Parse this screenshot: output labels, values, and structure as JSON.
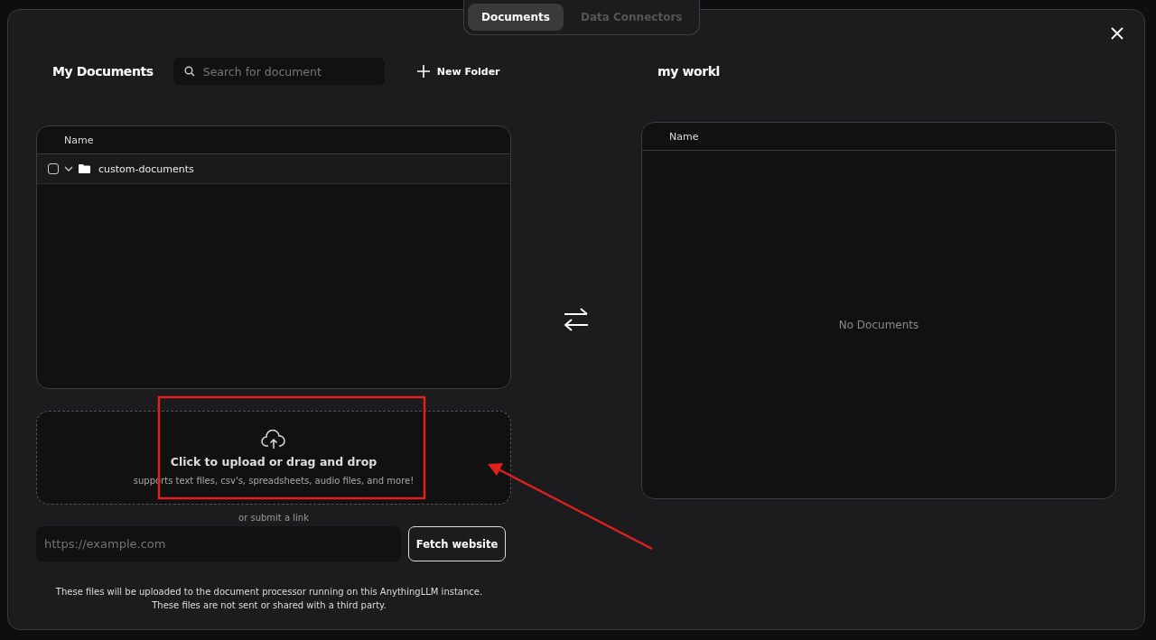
{
  "tabs": [
    {
      "label": "Documents",
      "selected": true
    },
    {
      "label": "Data Connectors",
      "selected": false
    }
  ],
  "my_documents": {
    "title": "My Documents",
    "search": {
      "placeholder": "Search for document"
    },
    "new_folder": "New Folder",
    "table": {
      "columns": [
        "Name"
      ],
      "rows": [
        {
          "name": "custom-documents",
          "kind": "folder",
          "checked": false,
          "expanded": true
        }
      ]
    }
  },
  "upload": {
    "title": "Click to upload or drag and drop",
    "subtitle": "supports text files, csv's, spreadsheets, audio files, and more!",
    "link_hint": "or submit a link",
    "url": {
      "placeholder": "https://example.com"
    },
    "fetch_button": "Fetch website",
    "notice": [
      "These files will be uploaded to the document processor running on this AnythingLLM instance.",
      "These files are not sent or shared with a third party."
    ]
  },
  "workspace": {
    "title": "my workl",
    "table": {
      "columns": [
        "Name"
      ],
      "empty_text": "No Documents"
    }
  },
  "annotations": {
    "highlight_box": true,
    "arrow": true
  }
}
